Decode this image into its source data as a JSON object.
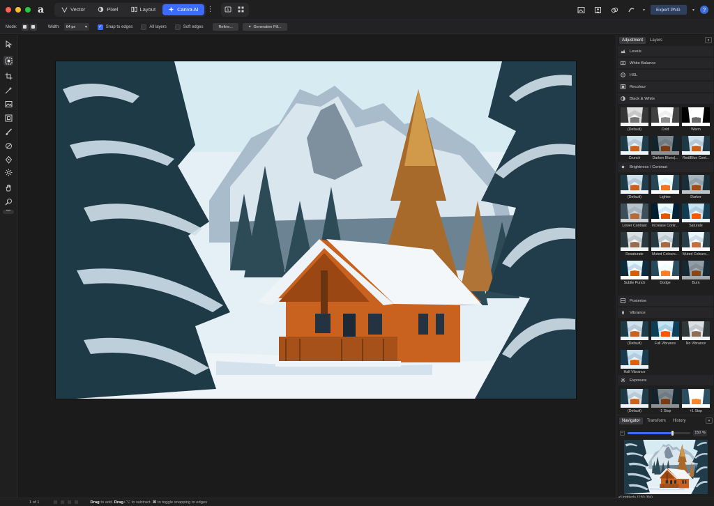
{
  "personas": [
    {
      "label": "Vector",
      "icon": "vector-pen-icon"
    },
    {
      "label": "Pixel",
      "icon": "pixel-brush-icon"
    },
    {
      "label": "Layout",
      "icon": "layout-columns-icon"
    },
    {
      "label": "Canva AI",
      "icon": "sparkle-icon",
      "active": true
    }
  ],
  "header": {
    "export_label": "Export PNG"
  },
  "context": {
    "mode_label": "Mode:",
    "width_label": "Width:",
    "width_value": "64 px",
    "snap_label": "Snap to edges",
    "all_layers_label": "All layers",
    "soft_edges_label": "Soft edges",
    "refine_label": "Refine...",
    "generative_label": "Generative Fill...",
    "snap_checked": true
  },
  "panel": {
    "tabs": [
      "Adjustment",
      "Layers"
    ],
    "sections": {
      "levels": "Levels",
      "white_balance": "White Balance",
      "hsl": "HSL",
      "recolour": "Recolour",
      "black_white": "Black & White",
      "brightness": "Brightness / Contrast",
      "posterise": "Posterise",
      "vibrance": "Vibrance",
      "exposure": "Exposure"
    },
    "bw_presets": [
      "(Default)",
      "Cold",
      "Warm",
      "Crunch",
      "Darken Blues|...",
      "Red/Blue Cont..."
    ],
    "bc_presets": [
      "(Default)",
      "Lighter",
      "Darker",
      "Lower Contrast",
      "Increase Contr...",
      "Saturate",
      "Desaturate",
      "Muted Colours...",
      "Muted Colours...",
      "Subtle Punch",
      "Dodge",
      "Burn"
    ],
    "vib_presets": [
      "(Default)",
      "Full Vibrance",
      "No Vibrance",
      "Half Vibrance"
    ],
    "exp_presets": [
      "(Default)",
      "-1 Stop",
      "+1 Stop"
    ]
  },
  "navigator": {
    "tabs": [
      "Navigator",
      "Transform",
      "History"
    ],
    "zoom": "150 %",
    "zoom_fraction": 0.71,
    "doc_name": "<Untitled> (150.0%)"
  },
  "status": {
    "page": "1 of 1",
    "hint_drag": "Drag",
    "hint_add": " to add. ",
    "hint_drag2": "Drag",
    "hint_subtract": "+⌥ to subtract. ",
    "hint_key": "⌘",
    "hint_toggle": " to toggle snapping to edges"
  },
  "colors": {
    "accent": "#3d6bff",
    "cabin": "#c8621e",
    "sky": "#dfeef5"
  }
}
